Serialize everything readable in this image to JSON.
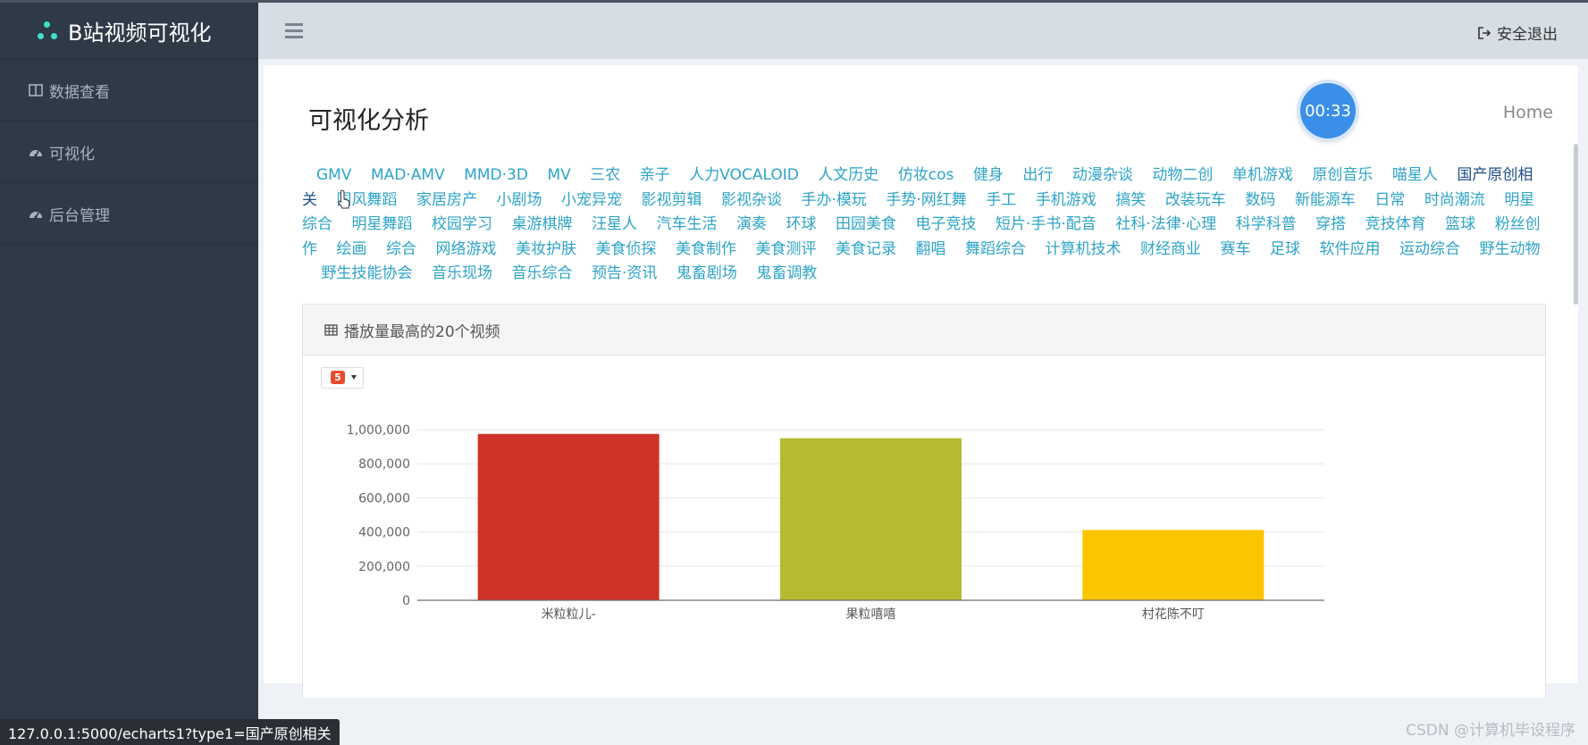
{
  "app": {
    "brand": "B站视频可视化"
  },
  "sidebar": {
    "items": [
      {
        "label": "数据查看",
        "icon": "columns-icon"
      },
      {
        "label": "可视化",
        "icon": "dashboard-icon"
      },
      {
        "label": "后台管理",
        "icon": "dashboard-icon"
      }
    ]
  },
  "header": {
    "logout_label": "安全退出",
    "menu_icon": "hamburger-icon"
  },
  "page": {
    "title": "可视化分析",
    "timer": "00:33",
    "breadcrumb": "Home"
  },
  "categories": [
    "GMV",
    "MAD·AMV",
    "MMD·3D",
    "MV",
    "三农",
    "亲子",
    "人力VOCALOID",
    "人文历史",
    "仿妆cos",
    "健身",
    "出行",
    "动漫杂谈",
    "动物二创",
    "单机游戏",
    "原创音乐",
    "喵星人",
    "国产原创相关",
    "国风舞蹈",
    "家居房产",
    "小剧场",
    "小宠异宠",
    "影视剪辑",
    "影视杂谈",
    "手办·模玩",
    "手势·网红舞",
    "手工",
    "手机游戏",
    "搞笑",
    "改装玩车",
    "数码",
    "新能源车",
    "日常",
    "时尚潮流",
    "明星综合",
    "明星舞蹈",
    "校园学习",
    "桌游棋牌",
    "汪星人",
    "汽车生活",
    "演奏",
    "环球",
    "田园美食",
    "电子竞技",
    "短片·手书·配音",
    "社科·法律·心理",
    "科学科普",
    "穿搭",
    "竞技体育",
    "篮球",
    "粉丝创作",
    "绘画",
    "综合",
    "网络游戏",
    "美妆护肤",
    "美食侦探",
    "美食制作",
    "美食测评",
    "美食记录",
    "翻唱",
    "舞蹈综合",
    "计算机技术",
    "财经商业",
    "赛车",
    "足球",
    "软件应用",
    "运动综合",
    "野生动物",
    "野生技能协会",
    "音乐现场",
    "音乐综合",
    "预告·资讯",
    "鬼畜剧场",
    "鬼畜调教"
  ],
  "active_category": "国产原创相关",
  "panel": {
    "title": "播放量最高的20个视频",
    "icon": "table-icon"
  },
  "chart_data": {
    "type": "bar",
    "categories": [
      "米粒粒儿-",
      "果粒嘻嘻",
      "村花陈不叮"
    ],
    "values": [
      975000,
      950000,
      412000
    ],
    "colors": [
      "#cf3228",
      "#b5bb2f",
      "#fbc500"
    ],
    "ylim": [
      0,
      1000000
    ],
    "yticks": [
      "0",
      "200,000",
      "400,000",
      "600,000",
      "800,000",
      "1,000,000"
    ],
    "grid": true
  },
  "statusbar": {
    "url": "127.0.0.1:5000/echarts1?type1=国产原创相关"
  },
  "watermark": "CSDN @计算机毕设程序"
}
